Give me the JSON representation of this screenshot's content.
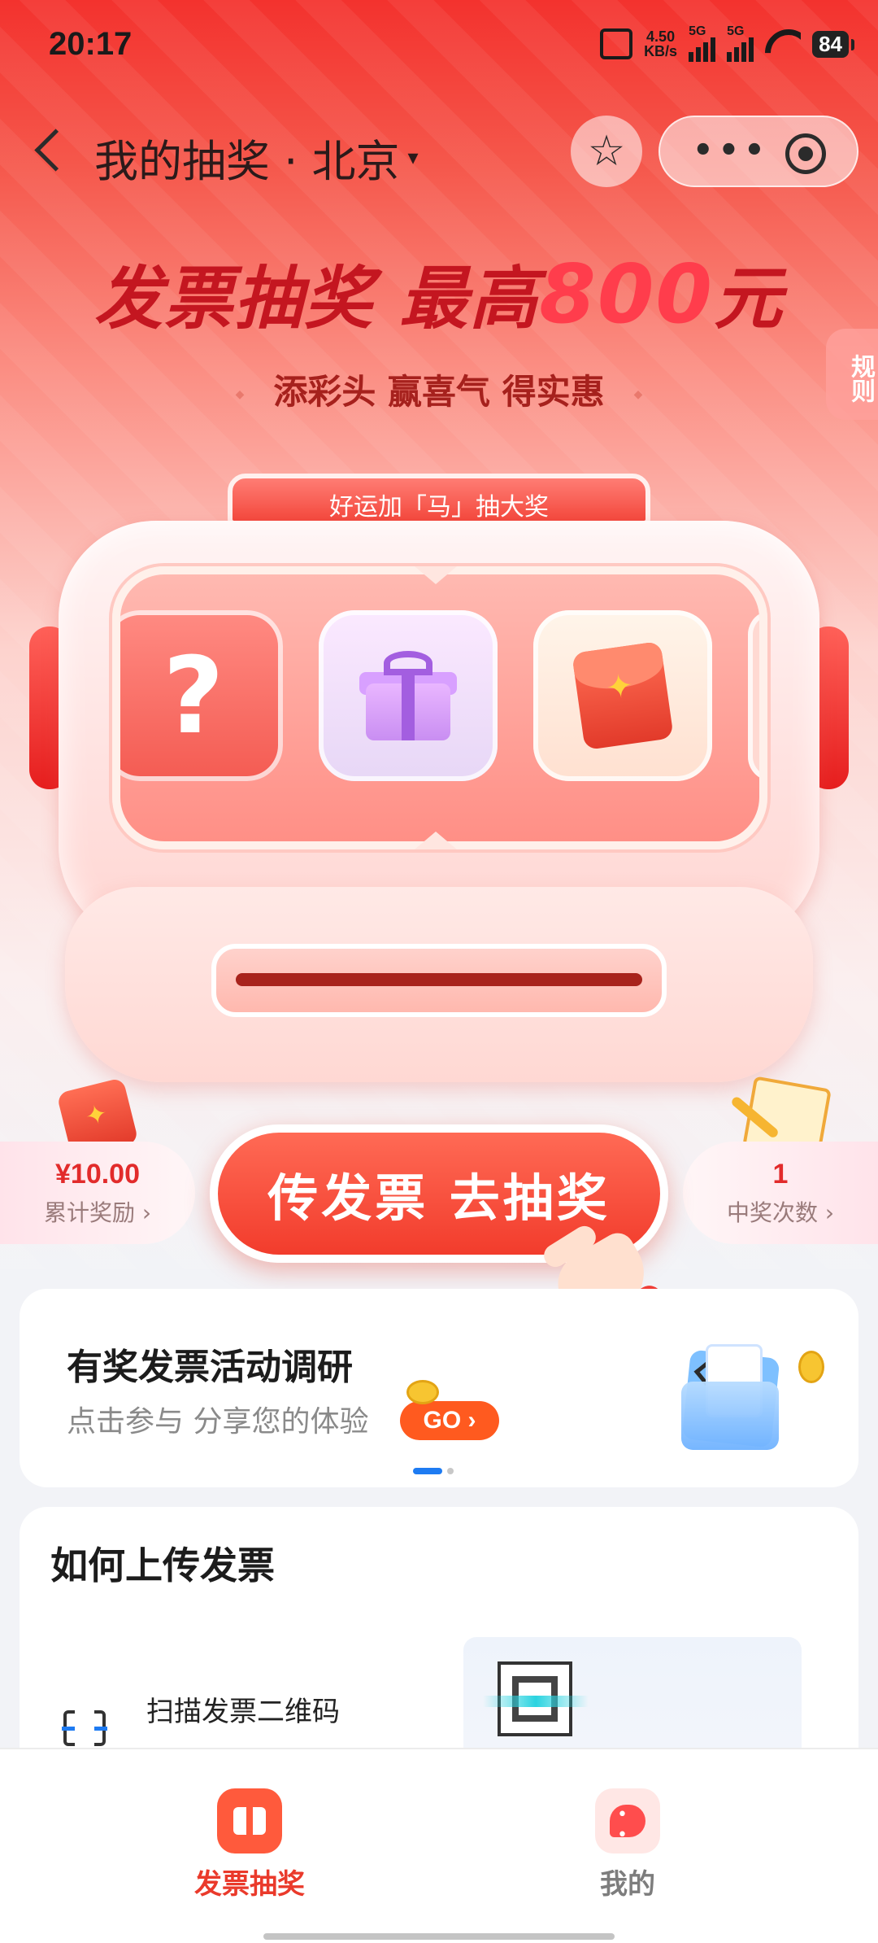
{
  "status_bar": {
    "time": "20:17",
    "net_speed_value": "4.50",
    "net_speed_unit": "KB/s",
    "signal1_label": "5G",
    "signal2_label": "5G",
    "battery": "84"
  },
  "nav": {
    "title": "我的抽奖 · 北京",
    "caret": "▾"
  },
  "hero": {
    "headline_pre": "发票抽奖 最高",
    "headline_amount": "800",
    "headline_post": "元",
    "tagline": "添彩头 赢喜气 得实惠",
    "rules_tab": "规则"
  },
  "machine": {
    "top_label": "好运加「马」抽大奖",
    "slots": [
      {
        "icon": "question-mark-icon",
        "text": "?"
      },
      {
        "icon": "gift-box-icon"
      },
      {
        "icon": "red-envelope-icon"
      }
    ]
  },
  "stats": {
    "reward_value": "¥10.00",
    "reward_label": "累计奖励 ›",
    "wins_value": "1",
    "wins_label": "中奖次数 ›"
  },
  "cta": {
    "label": "传发票 去抽奖"
  },
  "survey": {
    "title": "有奖发票活动调研",
    "subtitle": "点击参与 分享您的体验",
    "go_label": "GO ›",
    "pager_active": 0,
    "pager_count": 2
  },
  "howto": {
    "title": "如何上传发票",
    "step1": "扫描发票二维码"
  },
  "tabbar": {
    "items": [
      {
        "label": "发票抽奖",
        "active": true
      },
      {
        "label": "我的",
        "active": false
      }
    ]
  },
  "colors": {
    "accent": "#f23c2c",
    "brand_red": "#c41620",
    "go_orange": "#ff5a1f",
    "pager_active": "#1e7bf2"
  }
}
